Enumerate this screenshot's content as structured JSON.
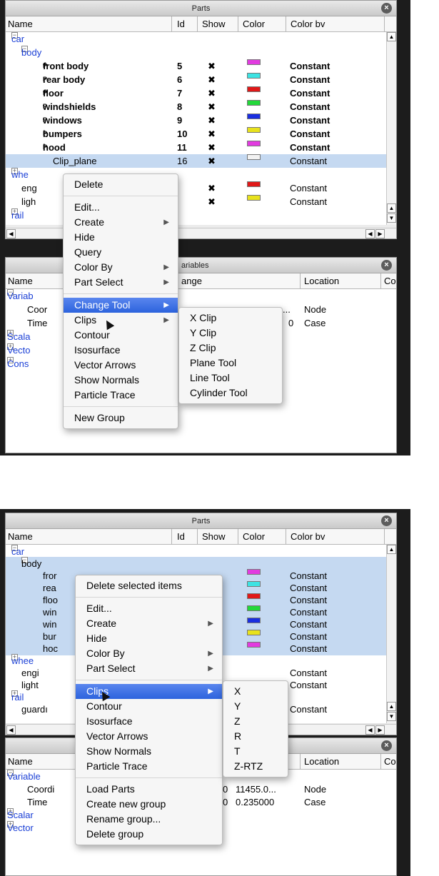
{
  "panel1": {
    "parts_title": "Parts",
    "parts_columns": [
      "Name",
      "Id",
      "Show",
      "Color",
      "Color bv"
    ],
    "tree": {
      "car": "car",
      "body": "body",
      "parts": [
        {
          "name": "front body",
          "id": "5",
          "show": "✖",
          "color": "#e23be0",
          "colorby": "Constant"
        },
        {
          "name": "rear body",
          "id": "6",
          "show": "✖",
          "color": "#3ce3e3",
          "colorby": "Constant"
        },
        {
          "name": "floor",
          "id": "7",
          "show": "✖",
          "color": "#e01818",
          "colorby": "Constant"
        },
        {
          "name": "windshields",
          "id": "8",
          "show": "✖",
          "color": "#22d83a",
          "colorby": "Constant"
        },
        {
          "name": "windows",
          "id": "9",
          "show": "✖",
          "color": "#1a2ee0",
          "colorby": "Constant"
        },
        {
          "name": "bumpers",
          "id": "10",
          "show": "✖",
          "color": "#e8e21c",
          "colorby": "Constant"
        },
        {
          "name": "hood",
          "id": "11",
          "show": "✖",
          "color": "#e23be0",
          "colorby": "Constant"
        }
      ],
      "clip_plane": {
        "name": "Clip_plane",
        "id": "16",
        "show": "✖",
        "color": "#f2f2f2",
        "colorby": "Constant"
      },
      "wheels_partial": "whe",
      "engine_partial": "eng",
      "engine": {
        "show": "✖",
        "color": "#e01818",
        "colorby": "Constant"
      },
      "lights_partial": "ligh",
      "lights": {
        "show": "✖",
        "color": "#e8e21c",
        "colorby": "Constant"
      },
      "rail": "rail"
    },
    "variables_title_partial": "ariables",
    "variables_columns": {
      "name": "Name",
      "range_partial": "ange",
      "location": "Location",
      "comment_partial": "Comi"
    },
    "variables_tree": {
      "variables_partial": "Variab",
      "coord_partial": "Coor",
      "coord_value_partial": "...",
      "coord_location": "Node",
      "time_partial": "Time",
      "time_value_partial": "0",
      "time_location": "Case",
      "scalars_partial": "Scala",
      "vectors_partial": "Vecto",
      "constants_partial": "Cons"
    },
    "context_menu": {
      "delete": "Delete",
      "edit": "Edit...",
      "create": "Create",
      "hide": "Hide",
      "query": "Query",
      "color_by": "Color By",
      "part_select": "Part Select",
      "change_tool": "Change Tool",
      "clips": "Clips",
      "contour": "Contour",
      "isosurface": "Isosurface",
      "vector_arrows": "Vector Arrows",
      "show_normals": "Show Normals",
      "particle_trace": "Particle Trace",
      "new_group": "New Group"
    },
    "submenu": [
      "X Clip",
      "Y Clip",
      "Z Clip",
      "Plane Tool",
      "Line Tool",
      "Cylinder Tool"
    ]
  },
  "panel2": {
    "parts_title": "Parts",
    "parts_columns": [
      "Name",
      "Id",
      "Show",
      "Color",
      "Color bv"
    ],
    "tree": {
      "car": "car",
      "body_partial": "body",
      "rows": [
        {
          "name": "fror",
          "color": "#e23be0",
          "colorby": "Constant"
        },
        {
          "name": "rea",
          "color": "#3ce3e3",
          "colorby": "Constant"
        },
        {
          "name": "floo",
          "color": "#e01818",
          "colorby": "Constant"
        },
        {
          "name": "win",
          "color": "#22d83a",
          "colorby": "Constant"
        },
        {
          "name": "win",
          "color": "#1a2ee0",
          "colorby": "Constant"
        },
        {
          "name": "bur",
          "color": "#e8e21c",
          "colorby": "Constant"
        },
        {
          "name": "hoc",
          "color": "#e23be0",
          "colorby": "Constant"
        }
      ],
      "wheels_partial": "whee",
      "engine_partial": "engi",
      "engine_colorby": "Constant",
      "lights_partial": "light",
      "lights_colorby": "Constant",
      "rail": "rail",
      "guard_partial": "guardı",
      "guard_colorby": "Constant"
    },
    "variables_columns": {
      "name": "Name",
      "location": "Location",
      "comment_partial": "Comi"
    },
    "variables_tree": {
      "variables_partial": "Variable",
      "coord_partial": "Coordi",
      "coord_value": "11455.0...",
      "coord_location": "Node",
      "time": "Time",
      "time_value": "0.235000",
      "time_location": "Case",
      "scalars_partial": "Scalar",
      "vectors_partial": "Vector",
      "zero1": "0",
      "zero2": "0"
    },
    "context_menu": {
      "delete_selected": "Delete selected items",
      "edit": "Edit...",
      "create": "Create",
      "hide": "Hide",
      "color_by": "Color By",
      "part_select": "Part Select",
      "clips": "Clips",
      "contour": "Contour",
      "isosurface": "Isosurface",
      "vector_arrows": "Vector Arrows",
      "show_normals": "Show Normals",
      "particle_trace": "Particle Trace",
      "load_parts": "Load Parts",
      "create_new_group": "Create new group",
      "rename_group": "Rename group...",
      "delete_group": "Delete group"
    },
    "submenu": [
      "X",
      "Y",
      "Z",
      "R",
      "T",
      "Z-RTZ"
    ]
  },
  "colors": {
    "highlight": "#2c63dd",
    "selection": "#c5d9f1",
    "link": "#1a3fd6"
  },
  "icons": {
    "close": "close-icon",
    "expand": "expand-icon",
    "arrow": "submenu-arrow-icon",
    "cursor": "pointer-cursor-icon"
  }
}
